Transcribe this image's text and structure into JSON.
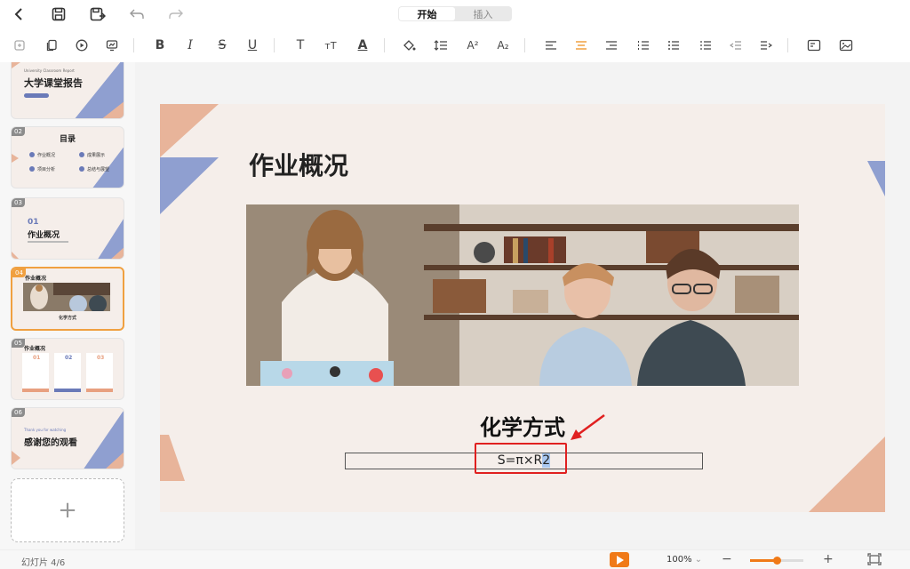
{
  "topbar": {
    "tabs": [
      {
        "label": "开始",
        "active": true
      },
      {
        "label": "插入",
        "active": false
      }
    ]
  },
  "toolbar": {
    "superscript_label": "A²",
    "subscript_label": "A₂"
  },
  "slides": [
    {
      "num": "",
      "title": "大学课堂报告",
      "subtitle": "University Classroom Report"
    },
    {
      "num": "02",
      "title": "目录",
      "items": [
        "作业概况",
        "成果展示",
        "项目分析",
        "总结与展望"
      ]
    },
    {
      "num": "03",
      "title": "作业概况",
      "index": "01"
    },
    {
      "num": "04",
      "title": "作业概况",
      "caption": "化学方式"
    },
    {
      "num": "05",
      "title": "作业概况",
      "cols": [
        "01",
        "02",
        "03"
      ]
    },
    {
      "num": "06",
      "title": "感谢您的观看",
      "subtitle": "Thank you for watching"
    }
  ],
  "main_slide": {
    "title": "作业概况",
    "subtitle": "化学方式",
    "formula_text": "S=π×R",
    "formula_selected": "2"
  },
  "status": {
    "slide_indicator": "幻灯片 4/6",
    "zoom": "100%",
    "zoom_minus": "−",
    "zoom_plus": "+",
    "zoom_level": 0.5
  },
  "colors": {
    "accent_orange": "#f0a040",
    "slide_bg": "#f5eeea",
    "shape_blue": "#8f9fd0",
    "shape_peach": "#e8b49a",
    "highlight_red": "#e02020",
    "play_button": "#f07a18"
  }
}
